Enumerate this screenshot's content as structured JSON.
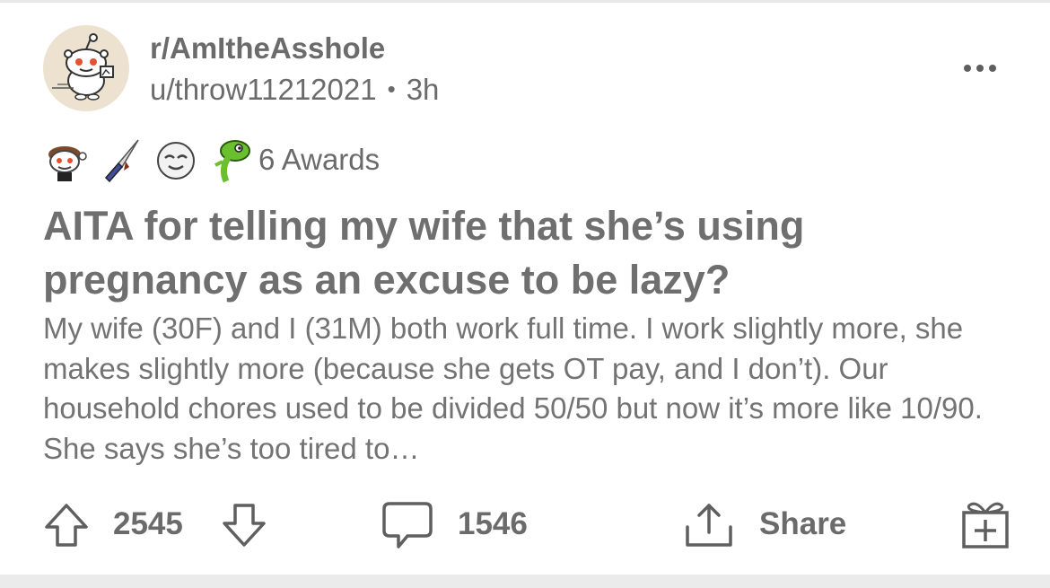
{
  "post": {
    "subreddit": "r/AmItheAsshole",
    "author": "u/throw11212021",
    "separator": "•",
    "age": "3h",
    "awards_label": "6 Awards",
    "title": "AITA for telling my wife that she’s using pregnancy as an excuse to be lazy?",
    "body_preview": "My wife (30F) and I (31M) both work full time. I work slightly more, she makes slightly more (because she gets OT pay, and I don’t). Our household chores used to be divided 50/50 but now it’s more like 10/90. She says she’s too tired to…"
  },
  "actions": {
    "upvotes": "2545",
    "comments": "1546",
    "share_label": "Share"
  },
  "icons": {
    "avatar": "snoo-avatar-icon",
    "more": "more-options-icon",
    "awards": [
      "snoo-award-icon",
      "knife-award-icon",
      "wink-face-award-icon",
      "lizard-award-icon"
    ],
    "upvote": "upvote-arrow-icon",
    "downvote": "downvote-arrow-icon",
    "comment": "comment-bubble-icon",
    "share": "share-icon",
    "gift": "gift-award-icon"
  },
  "colors": {
    "text_gray": "#6b6b6b",
    "avatar_bg": "#ece2cf",
    "snoo_eye": "#e5502e",
    "lizard_green": "#6abf2e",
    "knife_handle": "#3f4f9c"
  }
}
